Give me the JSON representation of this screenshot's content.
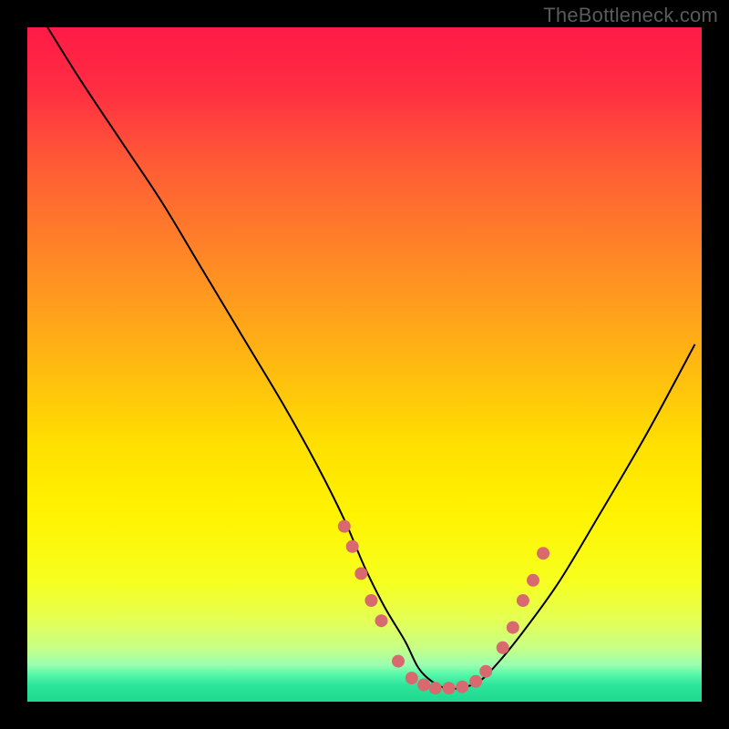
{
  "watermark": "TheBottleneck.com",
  "chart_data": {
    "type": "line",
    "title": "",
    "xlabel": "",
    "ylabel": "",
    "xlim": [
      0,
      100
    ],
    "ylim": [
      0,
      100
    ],
    "gradient_stops": [
      {
        "offset": 0.0,
        "color": "#ff1a47"
      },
      {
        "offset": 0.09,
        "color": "#ff2d42"
      },
      {
        "offset": 0.2,
        "color": "#ff5a36"
      },
      {
        "offset": 0.35,
        "color": "#ff8a25"
      },
      {
        "offset": 0.5,
        "color": "#ffb911"
      },
      {
        "offset": 0.62,
        "color": "#ffe000"
      },
      {
        "offset": 0.72,
        "color": "#fff300"
      },
      {
        "offset": 0.82,
        "color": "#f7ff1e"
      },
      {
        "offset": 0.88,
        "color": "#e4ff55"
      },
      {
        "offset": 0.92,
        "color": "#c7ff86"
      },
      {
        "offset": 0.945,
        "color": "#9cffb0"
      },
      {
        "offset": 0.96,
        "color": "#56f7a8"
      },
      {
        "offset": 0.975,
        "color": "#2de59c"
      },
      {
        "offset": 1.0,
        "color": "#1fd98f"
      }
    ],
    "series": [
      {
        "name": "curve",
        "x": [
          3,
          8,
          14,
          20,
          26,
          32,
          38,
          43,
          47,
          50,
          53,
          56,
          58,
          60,
          62,
          64,
          67,
          70,
          74,
          79,
          85,
          92,
          99
        ],
        "y": [
          100,
          92,
          83,
          74,
          64,
          54,
          44,
          35,
          27,
          20,
          14,
          9,
          5,
          3,
          2,
          2,
          3,
          6,
          11,
          18,
          28,
          40,
          53
        ]
      }
    ],
    "markers": {
      "name": "highlight-points",
      "color": "#d86a6f",
      "radius": 7,
      "points": [
        {
          "x": 47.0,
          "y": 26
        },
        {
          "x": 48.2,
          "y": 23
        },
        {
          "x": 49.5,
          "y": 19
        },
        {
          "x": 51.0,
          "y": 15
        },
        {
          "x": 52.5,
          "y": 12
        },
        {
          "x": 55.0,
          "y": 6
        },
        {
          "x": 57.0,
          "y": 3.5
        },
        {
          "x": 58.8,
          "y": 2.5
        },
        {
          "x": 60.5,
          "y": 2
        },
        {
          "x": 62.5,
          "y": 2
        },
        {
          "x": 64.5,
          "y": 2.2
        },
        {
          "x": 66.5,
          "y": 3
        },
        {
          "x": 68.0,
          "y": 4.5
        },
        {
          "x": 70.5,
          "y": 8
        },
        {
          "x": 72.0,
          "y": 11
        },
        {
          "x": 73.5,
          "y": 15
        },
        {
          "x": 75.0,
          "y": 18
        },
        {
          "x": 76.5,
          "y": 22
        }
      ]
    }
  }
}
